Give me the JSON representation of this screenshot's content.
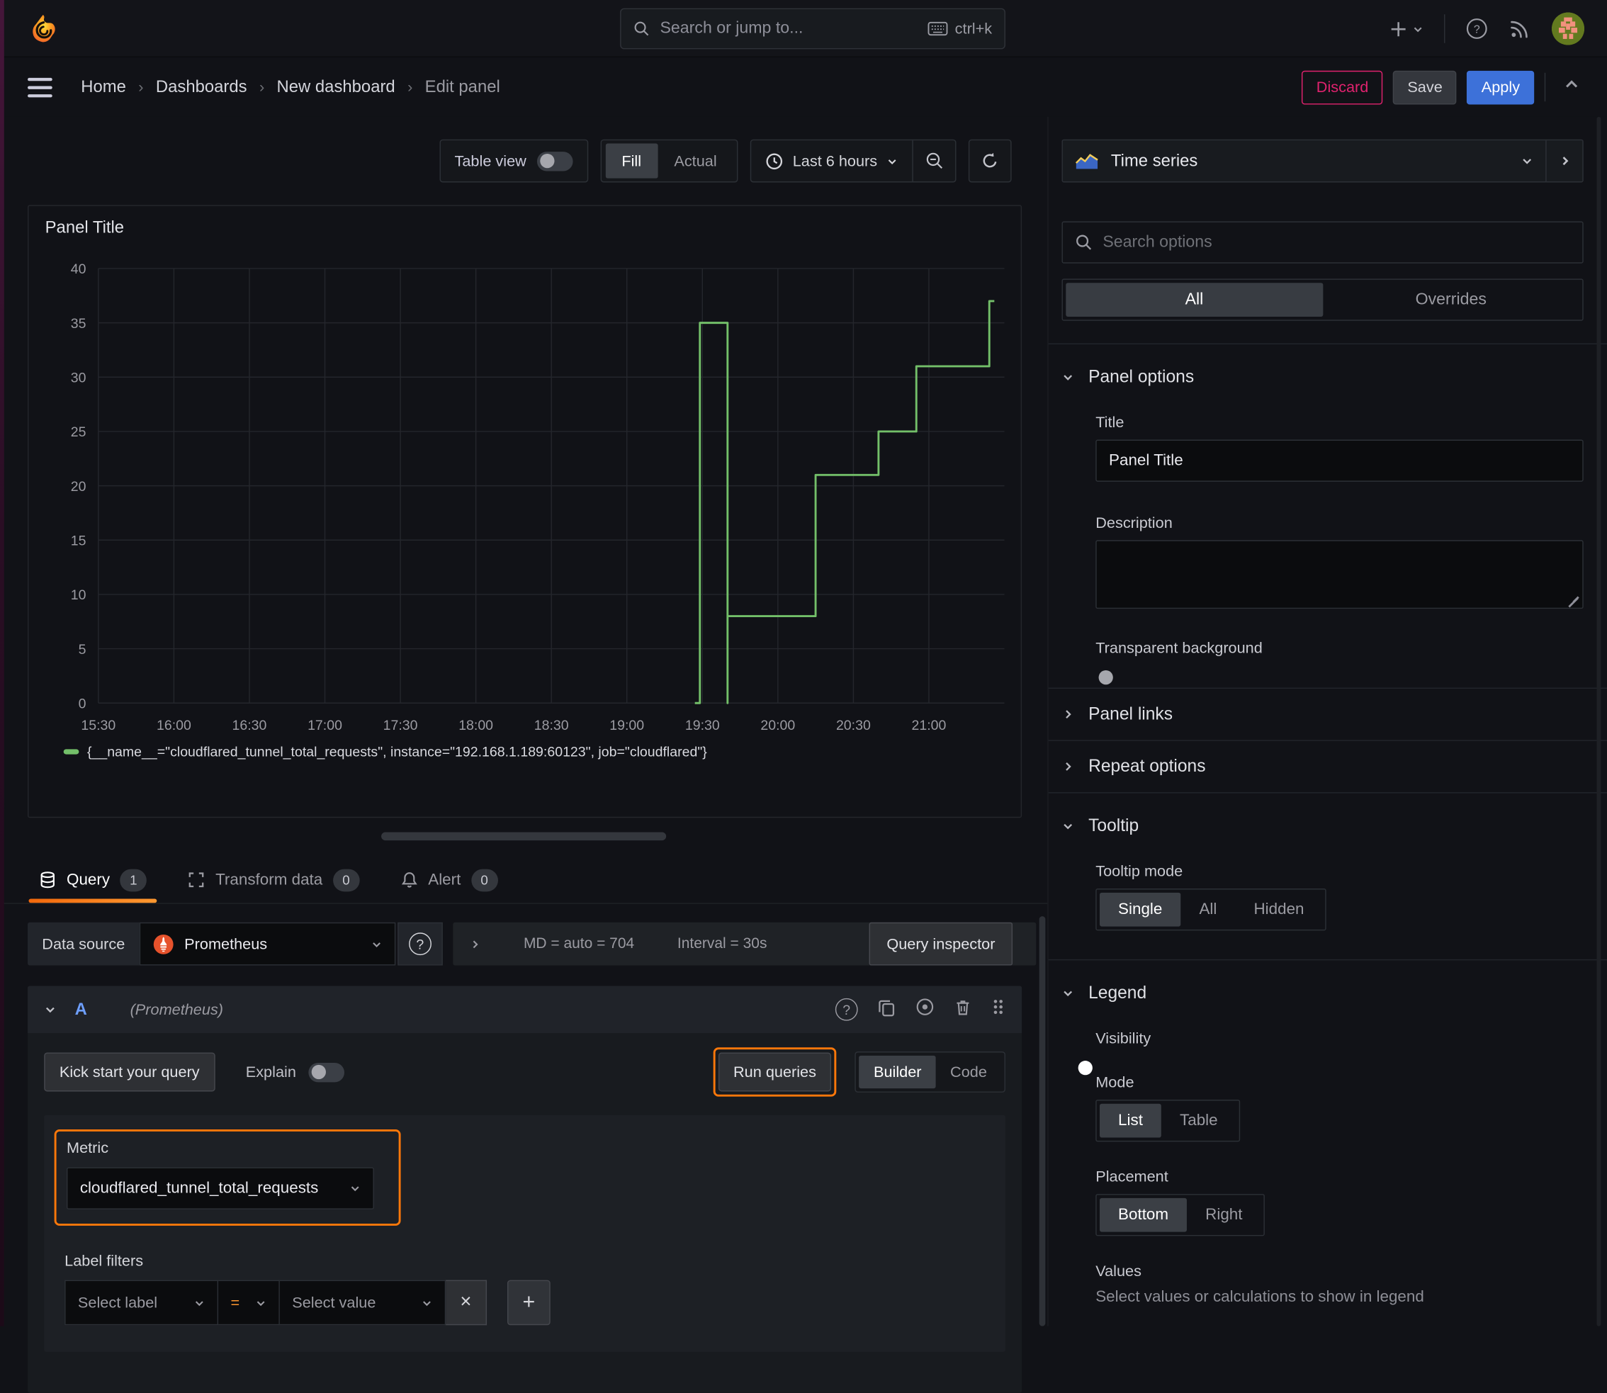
{
  "topbar": {
    "search_placeholder": "Search or jump to...",
    "shortcut": "ctrl+k"
  },
  "breadcrumb": {
    "items": [
      "Home",
      "Dashboards",
      "New dashboard",
      "Edit panel"
    ]
  },
  "actions": {
    "discard": "Discard",
    "save": "Save",
    "apply": "Apply"
  },
  "toolbar": {
    "table_view": "Table view",
    "fill": "Fill",
    "actual": "Actual",
    "time_range": "Last 6 hours"
  },
  "viz": {
    "type": "Time series"
  },
  "panel": {
    "title": "Panel Title"
  },
  "chart_data": {
    "type": "line",
    "title": "Panel Title",
    "step": true,
    "line_color": "#73bf69",
    "grid": true,
    "legend_position": "bottom",
    "x_ticks": [
      "15:30",
      "16:00",
      "16:30",
      "17:00",
      "17:30",
      "18:00",
      "18:30",
      "19:00",
      "19:30",
      "20:00",
      "20:30",
      "21:00"
    ],
    "y_ticks": [
      0,
      5,
      10,
      15,
      20,
      25,
      30,
      35,
      40
    ],
    "ylim": [
      0,
      40
    ],
    "x_range_minutes": [
      930,
      1290
    ],
    "series": [
      {
        "name": "{__name__=\"cloudflared_tunnel_total_requests\", instance=\"192.168.1.189:60123\", job=\"cloudflared\"}",
        "points": [
          [
            "19:27",
            0
          ],
          [
            "19:29",
            0
          ],
          [
            "19:29",
            35
          ],
          [
            "19:40",
            35
          ],
          [
            "19:40",
            0
          ],
          [
            "19:40",
            8
          ],
          [
            "20:15",
            8
          ],
          [
            "20:15",
            21
          ],
          [
            "20:40",
            21
          ],
          [
            "20:40",
            25
          ],
          [
            "20:55",
            25
          ],
          [
            "20:55",
            31
          ],
          [
            "21:24",
            31
          ],
          [
            "21:24",
            37
          ],
          [
            "21:26",
            37
          ]
        ]
      }
    ]
  },
  "tabs": {
    "query": "Query",
    "query_count": "1",
    "transform": "Transform data",
    "transform_count": "0",
    "alert": "Alert",
    "alert_count": "0"
  },
  "query": {
    "datasource_label": "Data source",
    "datasource": "Prometheus",
    "stats_md": "MD = auto = 704",
    "stats_interval": "Interval = 30s",
    "inspector": "Query inspector",
    "ref_id": "A",
    "ds_hint": "(Prometheus)",
    "kickstart": "Kick start your query",
    "explain": "Explain",
    "run": "Run queries",
    "builder": "Builder",
    "code": "Code",
    "metric_label": "Metric",
    "metric_value": "cloudflared_tunnel_total_requests",
    "label_filters": "Label filters",
    "select_label": "Select label",
    "operator": "=",
    "select_value": "Select value",
    "remove": "×",
    "add": "+"
  },
  "options": {
    "search_placeholder": "Search options",
    "tab_all": "All",
    "tab_overrides": "Overrides",
    "panel_options": "Panel options",
    "title_label": "Title",
    "title_value": "Panel Title",
    "description_label": "Description",
    "transparent_label": "Transparent background",
    "panel_links": "Panel links",
    "repeat_options": "Repeat options",
    "tooltip": "Tooltip",
    "tooltip_mode": "Tooltip mode",
    "tt_single": "Single",
    "tt_all": "All",
    "tt_hidden": "Hidden",
    "legend": "Legend",
    "visibility": "Visibility",
    "mode": "Mode",
    "mode_list": "List",
    "mode_table": "Table",
    "placement": "Placement",
    "pl_bottom": "Bottom",
    "pl_right": "Right",
    "values": "Values",
    "values_hint": "Select values or calculations to show in legend"
  },
  "colors": {
    "accent_orange": "#ff780a",
    "accent_blue": "#3d71d9",
    "accent_pink": "#e0226e",
    "series_green": "#73bf69"
  }
}
